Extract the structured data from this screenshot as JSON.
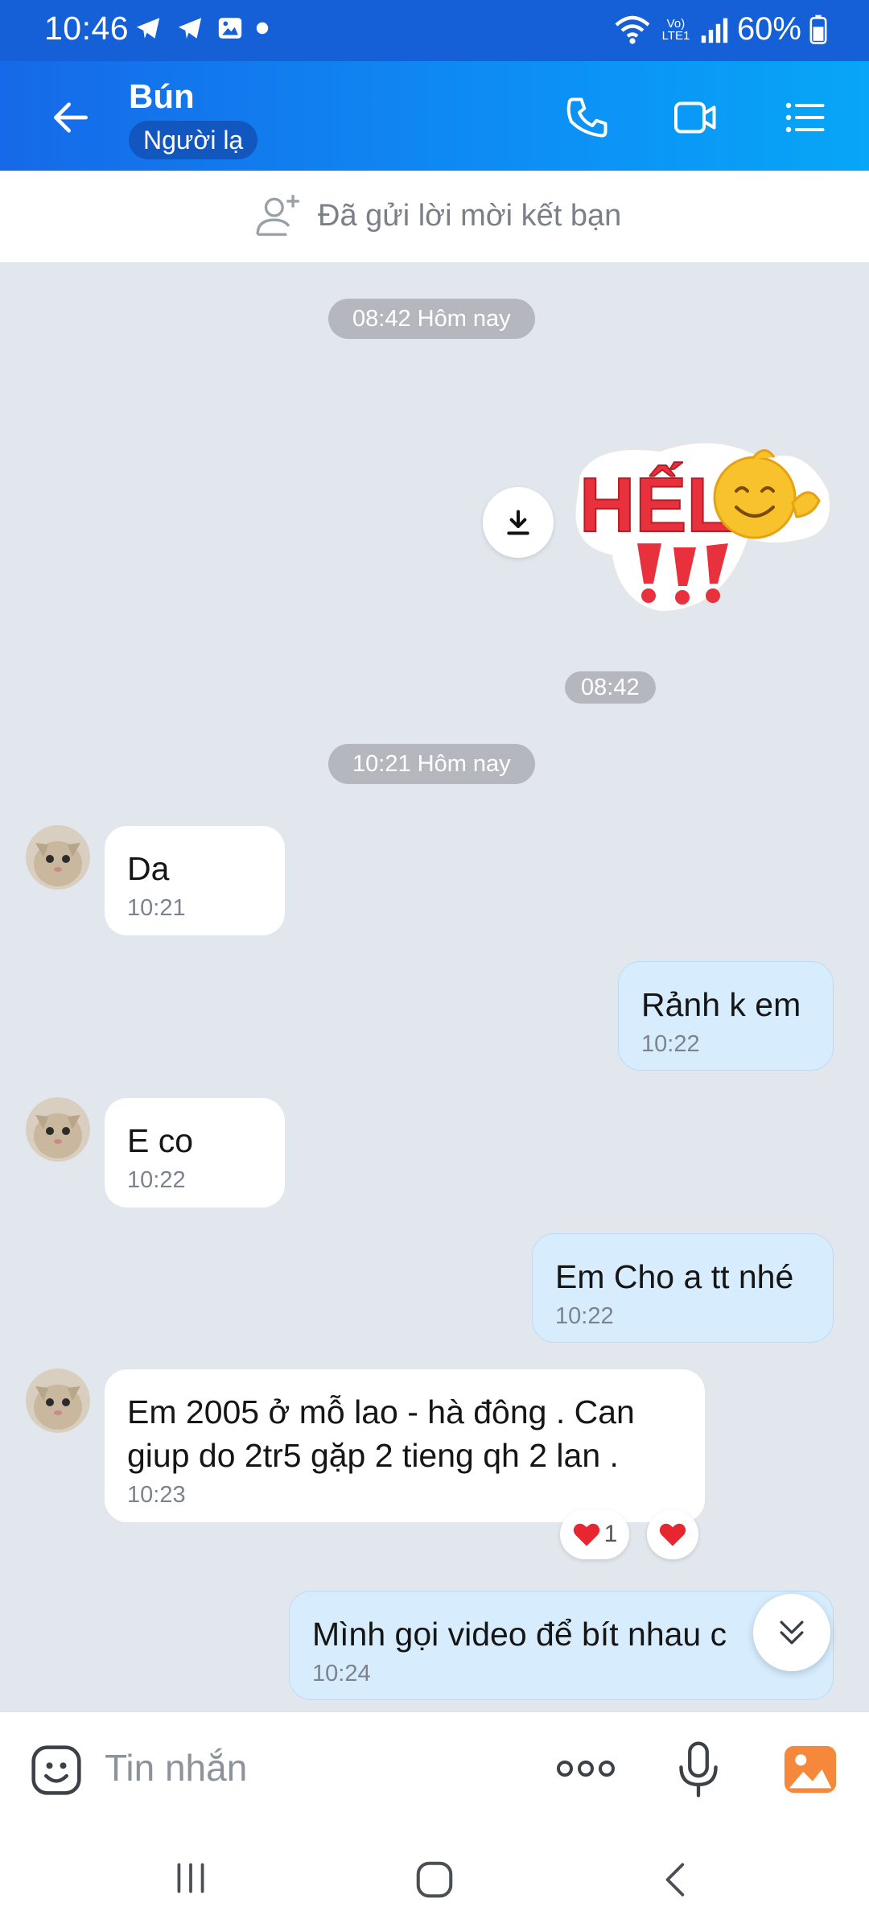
{
  "status_bar": {
    "time": "10:46",
    "network_label": "Vo) LTE1",
    "battery": "60%"
  },
  "header": {
    "contact_name": "Bún",
    "contact_tag": "Người lạ"
  },
  "friend_banner": {
    "text": "Đã gửi lời mời kết bạn"
  },
  "chat": {
    "separators": [
      "08:42 Hôm nay",
      "10:21 Hôm nay"
    ],
    "sticker": {
      "text": "HẾLO",
      "time": "08:42"
    },
    "messages": [
      {
        "direction": "in",
        "text": "Da",
        "time": "10:21"
      },
      {
        "direction": "out",
        "text": "Rảnh k em",
        "time": "10:22"
      },
      {
        "direction": "in",
        "text": "E co",
        "time": "10:22"
      },
      {
        "direction": "out",
        "text": "Em Cho a tt nhé",
        "time": "10:22"
      },
      {
        "direction": "in",
        "text": "Em  2005 ở mỗ lao - hà đông . Can giup do  2tr5  gặp 2 tieng qh 2 lan .",
        "time": "10:23"
      },
      {
        "direction": "out",
        "text": "Mình gọi video để bít nhau c",
        "time": "10:24"
      }
    ],
    "reaction_count": "1"
  },
  "input_bar": {
    "placeholder": "Tin nhắn"
  },
  "colors": {
    "header_start": "#1669e8",
    "header_end": "#07a6f7",
    "chat_bg": "#e2e7ee",
    "outgoing_bubble": "#d7edfd",
    "incoming_bubble": "#ffffff",
    "heart": "#e8262f"
  }
}
